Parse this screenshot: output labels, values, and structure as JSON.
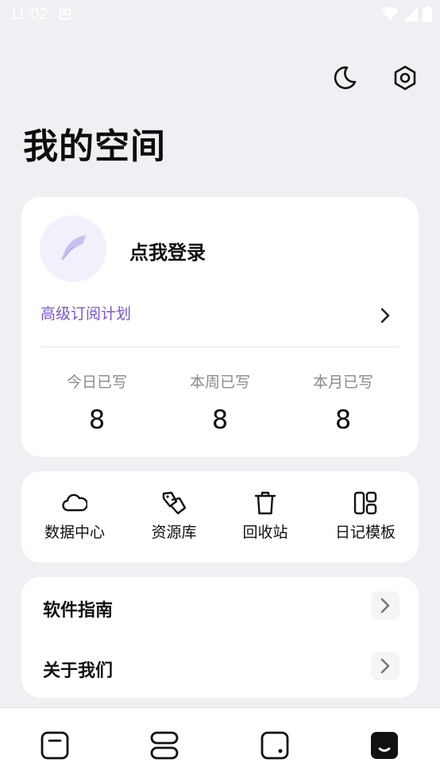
{
  "status_bar": {
    "time": "11:02"
  },
  "header": {
    "title": "我的空间",
    "moon_icon": "moon-icon",
    "settings_icon": "gear-icon"
  },
  "profile": {
    "avatar_icon": "feather-icon",
    "login_label": "点我登录",
    "subscription_label": "高级订阅计划",
    "stats": [
      {
        "label": "今日已写",
        "value": "8"
      },
      {
        "label": "本周已写",
        "value": "8"
      },
      {
        "label": "本月已写",
        "value": "8"
      }
    ]
  },
  "tools": [
    {
      "label": "数据中心",
      "icon": "cloud-icon"
    },
    {
      "label": "资源库",
      "icon": "tags-icon"
    },
    {
      "label": "回收站",
      "icon": "trash-icon"
    },
    {
      "label": "日记模板",
      "icon": "template-icon"
    }
  ],
  "links": [
    {
      "label": "软件指南"
    },
    {
      "label": "关于我们"
    }
  ],
  "tabbar": {
    "tabs": [
      {
        "icon": "note-icon",
        "active": false
      },
      {
        "icon": "list-icon",
        "active": false
      },
      {
        "icon": "square-dot-icon",
        "active": false
      },
      {
        "icon": "profile-icon",
        "active": true
      }
    ]
  },
  "colors": {
    "background": "#eff0f4",
    "accent_purple": "#7a55d4",
    "card": "#ffffff",
    "text_primary": "#111111",
    "text_secondary": "#8a8a8e"
  }
}
